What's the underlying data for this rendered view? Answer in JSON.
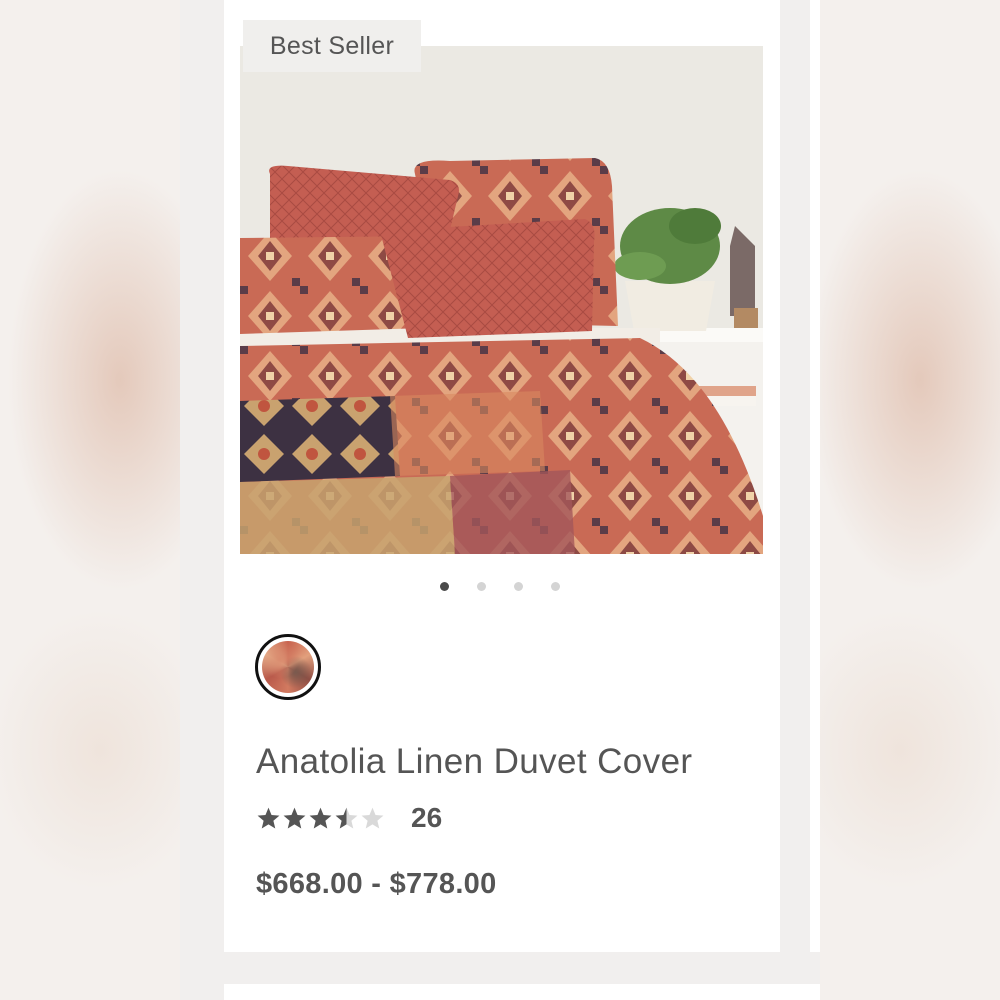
{
  "badge": "Best Seller",
  "carousel": {
    "count": 4,
    "active_index": 0
  },
  "swatches": [
    {
      "icon": "patterned-swatch",
      "selected": true
    }
  ],
  "product": {
    "title": "Anatolia Linen Duvet Cover",
    "rating": 3.5,
    "rating_max": 5,
    "review_count": "26",
    "price": "$668.00 - $778.00"
  },
  "colors": {
    "star_filled": "#555555",
    "star_empty": "#d9d9d9",
    "text": "#555555",
    "dot_active": "#4a4a4a",
    "dot_inactive": "#d4d4d4"
  }
}
